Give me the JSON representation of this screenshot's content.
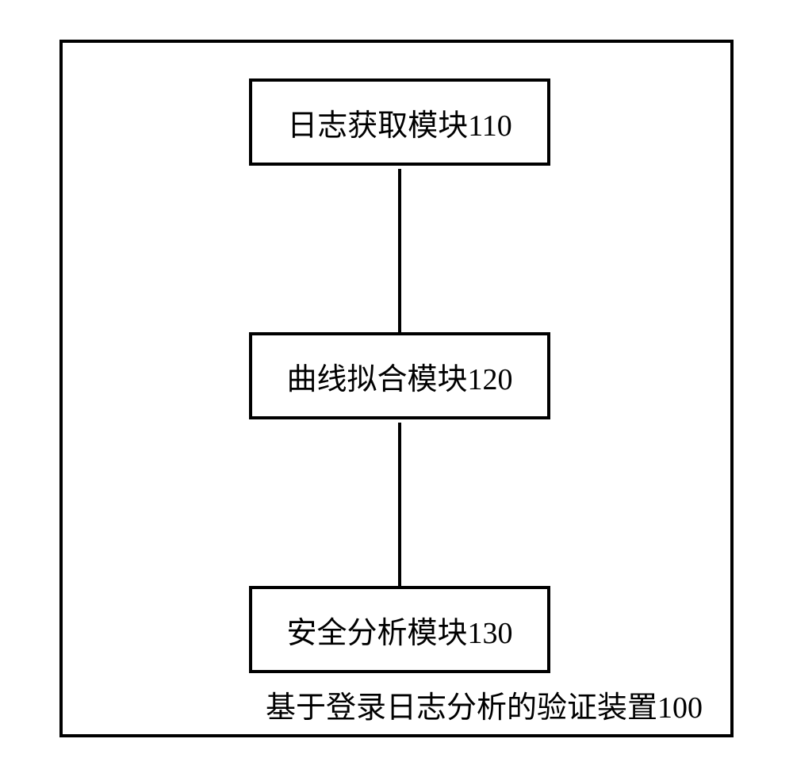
{
  "diagram": {
    "modules": [
      {
        "label": "日志获取模块110"
      },
      {
        "label": "曲线拟合模块120"
      },
      {
        "label": "安全分析模块130"
      }
    ],
    "device_label": "基于登录日志分析的验证装置100"
  }
}
